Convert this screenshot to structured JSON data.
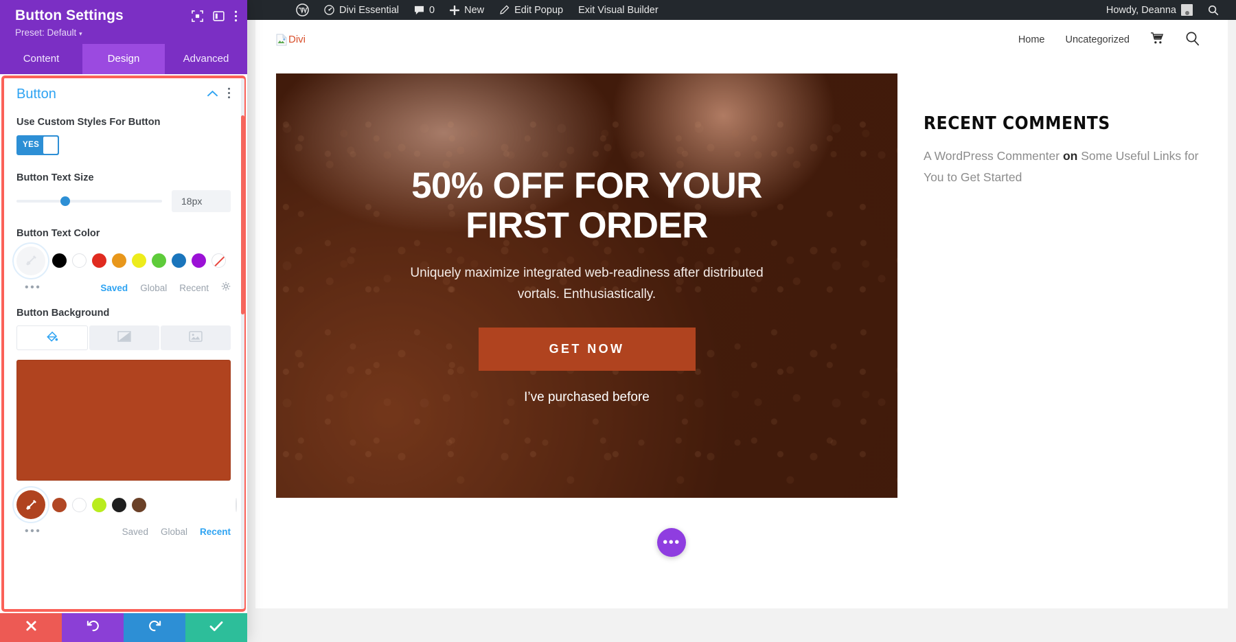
{
  "adminbar": {
    "items": [
      {
        "icon": "wordpress-logo-icon",
        "label": ""
      },
      {
        "icon": "dashboard-icon",
        "label": "Divi Essential"
      },
      {
        "icon": "comment-icon",
        "label": "0"
      },
      {
        "icon": "plus-icon",
        "label": "New"
      },
      {
        "icon": "pencil-icon",
        "label": "Edit Popup"
      },
      {
        "icon": "",
        "label": "Exit Visual Builder"
      }
    ],
    "howdy": "Howdy, Deanna",
    "search_icon": "search-icon"
  },
  "panel": {
    "title": "Button Settings",
    "preset": "Preset: Default",
    "preset_caret": "▾",
    "header_icons": [
      "target-icon",
      "layout-columns-icon",
      "more-vertical-icon"
    ],
    "tabs": [
      {
        "label": "Content",
        "active": false
      },
      {
        "label": "Design",
        "active": true
      },
      {
        "label": "Advanced",
        "active": false
      }
    ],
    "section": {
      "title": "Button",
      "collapse_icon": "chevron-up-icon",
      "more_icon": "more-vertical-icon"
    },
    "fields": {
      "custom_styles": {
        "label": "Use Custom Styles For Button",
        "toggle_value": "YES"
      },
      "text_size": {
        "label": "Button Text Size",
        "value": "18px",
        "slider_percent": 30
      },
      "text_color": {
        "label": "Button Text Color",
        "eyedropper": "eyedropper-icon",
        "swatches": [
          "#000000",
          "#ffffff",
          "#e02b20",
          "#e8971b",
          "#edec1c",
          "#5ecb3a",
          "#1a75bc",
          "#9b11d6"
        ],
        "transparent_swatch": "transparent-swatch",
        "dots": "•••",
        "meta_tabs": [
          {
            "label": "Saved",
            "active": true
          },
          {
            "label": "Global",
            "active": false
          },
          {
            "label": "Recent",
            "active": false
          }
        ],
        "gear_icon": "gear-icon"
      },
      "background": {
        "label": "Button Background",
        "type_tabs": [
          {
            "icon": "paint-bucket-icon",
            "active": true
          },
          {
            "icon": "gradient-icon",
            "active": false
          },
          {
            "icon": "image-icon",
            "active": false
          }
        ],
        "preview_color": "#b0431f",
        "eyedropper": "eyedropper-icon",
        "eyedropper_color": "#b0431f",
        "swatches": [
          "#b14724",
          "#ffffff",
          "#b9ec1e",
          "#1f1f1f",
          "#6b4128"
        ],
        "transparent_swatch": "transparent-swatch",
        "dots": "•••",
        "meta_tabs": [
          {
            "label": "Saved",
            "active": false
          },
          {
            "label": "Global",
            "active": false
          },
          {
            "label": "Recent",
            "active": true
          }
        ]
      }
    },
    "footer_buttons": [
      {
        "name": "cancel-button",
        "icon": "close-icon",
        "color": "#ed5a54"
      },
      {
        "name": "undo-button",
        "icon": "undo-icon",
        "color": "#8b3fd6"
      },
      {
        "name": "redo-button",
        "icon": "redo-icon",
        "color": "#2d8fd5"
      },
      {
        "name": "save-button",
        "icon": "check-icon",
        "color": "#2dbe9a"
      }
    ],
    "highlight_color": "#fb6158"
  },
  "site": {
    "logo_alt": "Divi",
    "nav": [
      {
        "label": "Home"
      },
      {
        "label": "Uncategorized"
      }
    ],
    "nav_icons": [
      "cart-icon",
      "search-icon"
    ],
    "hero": {
      "heading": "50% OFF FOR YOUR FIRST ORDER",
      "subtext": "Uniquely maximize integrated web-readiness after distributed vortals. Enthusiastically.",
      "cta_label": "GET NOW",
      "note": "I’ve purchased before"
    },
    "sidebar": {
      "widget_title": "RECENT COMMENTS",
      "comment_author": "A WordPress Commenter",
      "comment_on": "on",
      "comment_post": "Some Useful Links for You to Get Started"
    },
    "fab_icon": "ellipsis-icon",
    "fab_label": "•••"
  }
}
